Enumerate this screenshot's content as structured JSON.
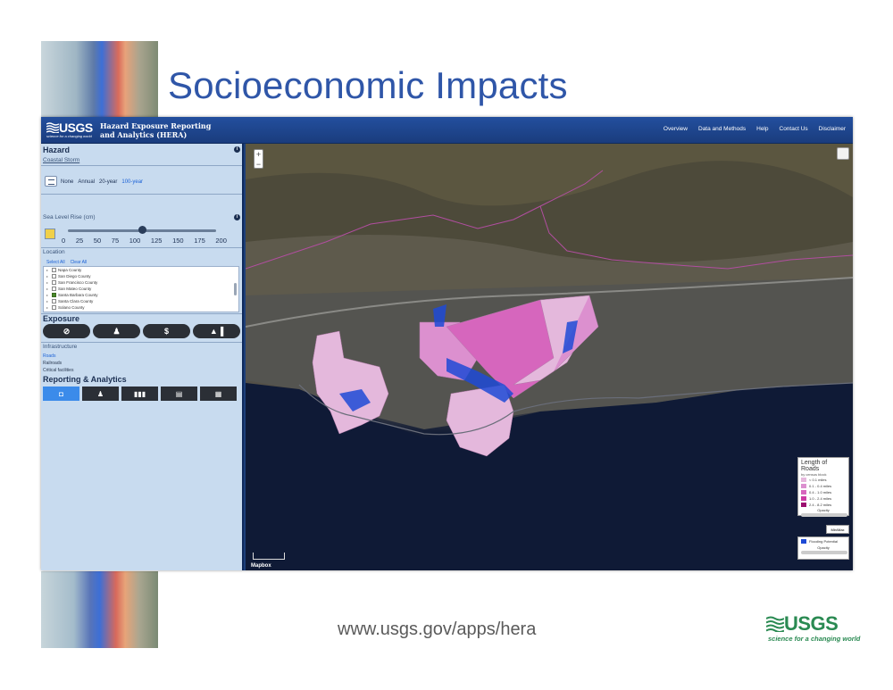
{
  "slide": {
    "title": "Socioeconomic Impacts",
    "footer_url": "www.usgs.gov/apps/hera",
    "logo_word": "USGS",
    "logo_tagline": "science for a changing world"
  },
  "app": {
    "logo_word": "USGS",
    "logo_tagline": "science for a changing world",
    "title_line1": "Hazard Exposure Reporting",
    "title_line2": "and Analytics (HERA)",
    "nav": [
      "Overview",
      "Data and Methods",
      "Help",
      "Contact Us",
      "Disclaimer"
    ]
  },
  "sidebar": {
    "hazard_heading": "Hazard",
    "hazard_type": "Coastal Storm",
    "frequency": [
      "None",
      "Annual",
      "20-year",
      "100-year"
    ],
    "frequency_selected": "100-year",
    "slr_label": "Sea Level Rise (cm)",
    "slr_ticks": [
      "0",
      "25",
      "50",
      "75",
      "100",
      "125",
      "150",
      "175",
      "200"
    ],
    "slr_value": 100,
    "location_label": "Location",
    "select_all": "Select All",
    "clear_all": "Clear All",
    "locations": [
      {
        "name": "Napa County",
        "checked": false
      },
      {
        "name": "San Diego County",
        "checked": false
      },
      {
        "name": "San Francisco County",
        "checked": false
      },
      {
        "name": "San Mateo County",
        "checked": false
      },
      {
        "name": "Santa Barbara County",
        "checked": true
      },
      {
        "name": "Santa Clara County",
        "checked": false
      },
      {
        "name": "Solano County",
        "checked": false
      },
      {
        "name": "Sonoma County",
        "checked": false
      }
    ],
    "exposure_heading": "Exposure",
    "exposure_buttons": [
      {
        "icon": "none-icon",
        "glyph": "⊘",
        "active": false
      },
      {
        "icon": "person-icon",
        "glyph": "♟",
        "active": false
      },
      {
        "icon": "dollar-icon",
        "glyph": "$",
        "active": false
      },
      {
        "icon": "building-icon",
        "glyph": "▲▐",
        "active": false
      },
      {
        "icon": "road-icon",
        "glyph": "▲",
        "active": true
      }
    ],
    "infrastructure_label": "Infrastructure",
    "infrastructure_items": [
      "Roads",
      "Railroads",
      "Critical facilities"
    ],
    "infrastructure_selected": "Roads",
    "reporting_heading": "Reporting & Analytics",
    "reporting_buttons": [
      {
        "icon": "map-pin-icon",
        "glyph": "◘",
        "active": true
      },
      {
        "icon": "chart-person-icon",
        "glyph": "♟",
        "active": false
      },
      {
        "icon": "bar-chart-icon",
        "glyph": "▮▮▮",
        "active": false
      },
      {
        "icon": "layers-icon",
        "glyph": "▤",
        "active": false
      },
      {
        "icon": "table-icon",
        "glyph": "▦",
        "active": false
      }
    ]
  },
  "map": {
    "zoom_in": "+",
    "zoom_out": "−",
    "attribution": "Mapbox",
    "legend_title": "Length of Roads",
    "legend_subtitle": "by census block",
    "legend_items": [
      {
        "label": "< 0.1 miles",
        "color": "#e6b7dc"
      },
      {
        "label": "0.1 - 0.4 miles",
        "color": "#dc90cf"
      },
      {
        "label": "0.4 - 1.0 miles",
        "color": "#d666bd"
      },
      {
        "label": "1.0 - 2.4 miles",
        "color": "#cc3aa3"
      },
      {
        "label": "2.4 - 8.2 miles",
        "color": "#9c0f6f"
      }
    ],
    "opacity_label": "Opacity",
    "minmax_label": "Min/Max",
    "flood_label": "Flooding Potential",
    "flood_color": "#1e4ad6",
    "flood_opacity_label": "Opacity"
  },
  "colors": {
    "title_blue": "#2f56a8",
    "header_blue": "#1f4690",
    "sidebar_bg": "#c8dbef",
    "active_button": "#3b8bea",
    "usgs_green": "#2a8a52"
  }
}
